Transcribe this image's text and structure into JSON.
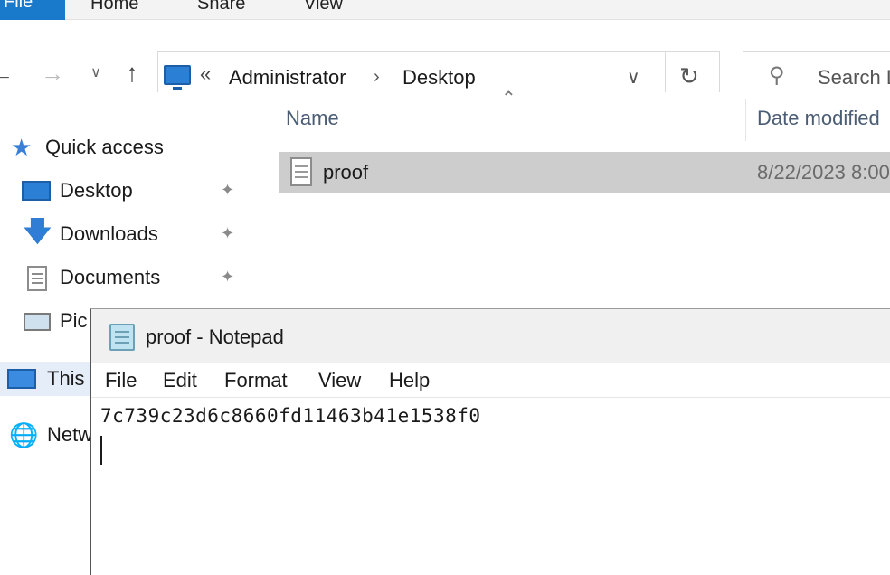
{
  "ribbon": {
    "tabs": [
      "File",
      "Home",
      "Share",
      "View"
    ]
  },
  "nav": {
    "back_icon": "arrow-left",
    "forward_icon": "arrow-right",
    "recent_icon": "chevron-down",
    "up_icon": "arrow-up"
  },
  "address": {
    "overflow": "«",
    "crumbs": [
      "Administrator",
      "Desktop"
    ],
    "separator": "›"
  },
  "search": {
    "placeholder": "Search D"
  },
  "sidebar": {
    "items": [
      {
        "label": "Quick access",
        "icon": "star-icon"
      },
      {
        "label": "Desktop",
        "icon": "desktop-icon",
        "pinned": true
      },
      {
        "label": "Downloads",
        "icon": "download-icon",
        "pinned": true
      },
      {
        "label": "Documents",
        "icon": "document-icon",
        "pinned": true
      },
      {
        "label": "Pic",
        "icon": "pictures-icon"
      },
      {
        "label": "This",
        "icon": "pc-icon"
      },
      {
        "label": "Netw",
        "icon": "network-icon"
      }
    ]
  },
  "filelist": {
    "columns": {
      "name": "Name",
      "date": "Date modified"
    },
    "files": [
      {
        "name": "proof",
        "date": "8/22/2023 8:00"
      }
    ]
  },
  "notepad": {
    "title": "proof - Notepad",
    "menus": [
      "File",
      "Edit",
      "Format",
      "View",
      "Help"
    ],
    "content": "7c739c23d6c8660fd11463b41e1538f0"
  },
  "colors": {
    "accent": "#1979ca",
    "selection": "#cdcdcd"
  }
}
